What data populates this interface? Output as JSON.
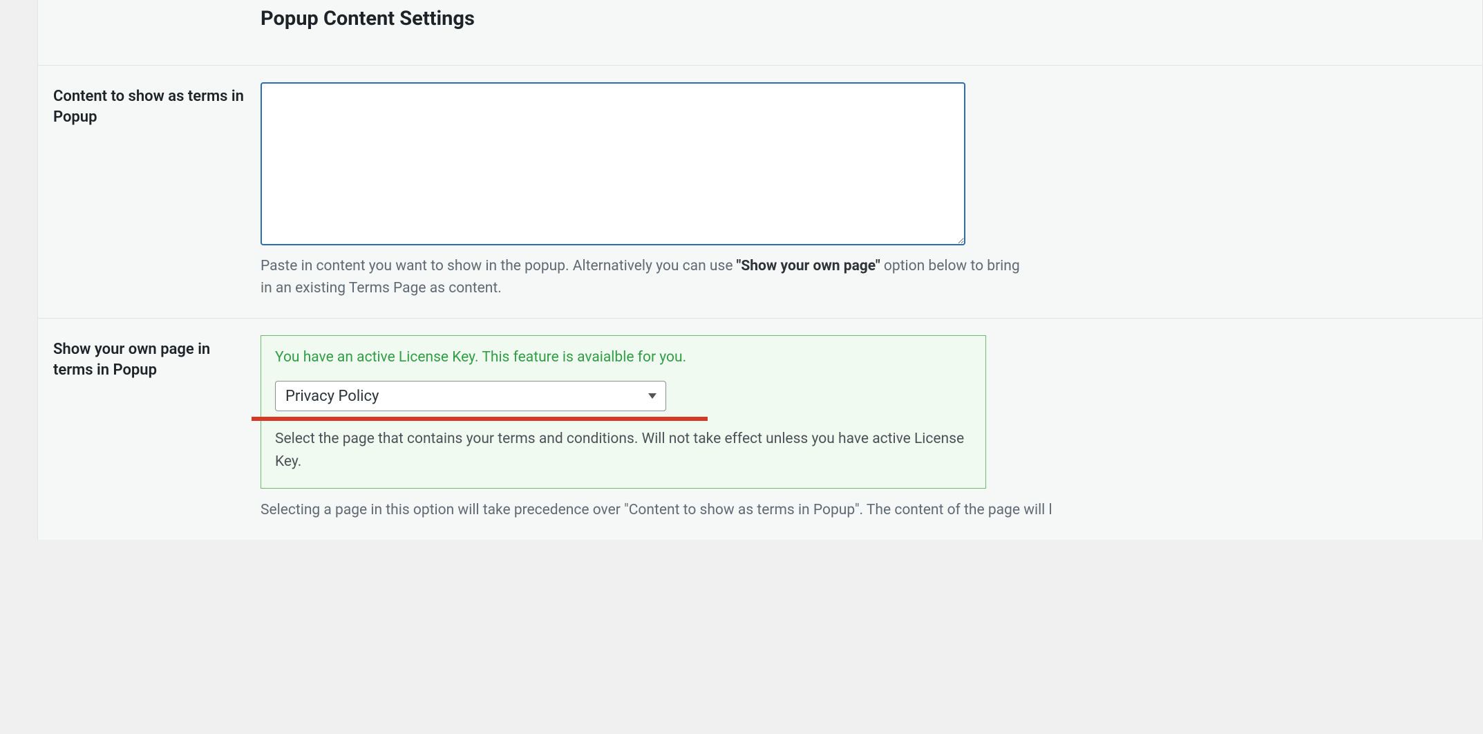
{
  "header": {
    "title": "Popup Content Settings"
  },
  "row1": {
    "label": "Content to show as terms in Popup",
    "textarea_value": "",
    "helper_pre": "Paste in content you want to show in the popup.\nAlternatively you can use ",
    "helper_strong": "\"Show your own page\"",
    "helper_post": " option below to bring in an existing Terms Page as content."
  },
  "row2": {
    "label": "Show your own page in terms in Popup",
    "license_msg": "You have an active License Key. This feature is avaialble for you.",
    "selected_page": "Privacy Policy",
    "green_help": "Select the page that contains your terms and conditions. Will not take effect unless you have active License Key.",
    "trailing_help": "Selecting a page in this option will take precedence over \"Content to show as terms in Popup\". The content of the page will l"
  }
}
